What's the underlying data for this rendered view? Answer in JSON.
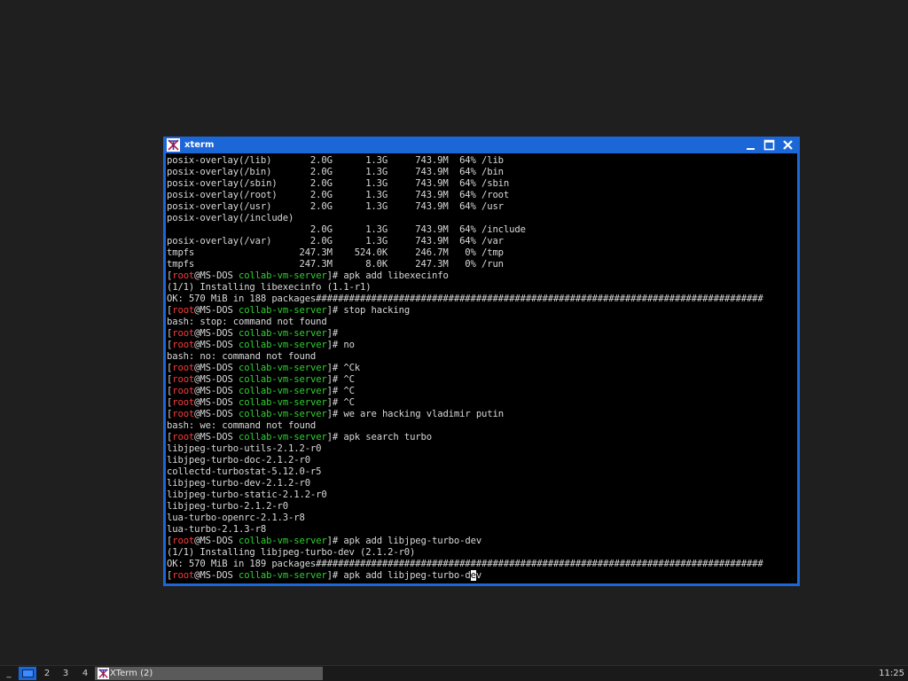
{
  "window": {
    "title": "xterm",
    "colors": {
      "titlebar": "#1c67d8",
      "terminal_bg": "#000000",
      "text": "#d8d8d8",
      "user": "#ff3a3a",
      "dir": "#2fd02f"
    }
  },
  "prompt": {
    "open": "[",
    "user": "root",
    "at": "@",
    "host": "MS-DOS",
    "space": " ",
    "dir": "collab-vm-server",
    "close": "]# "
  },
  "terminal": {
    "lines": [
      {
        "text": "posix-overlay(/lib)       2.0G      1.3G     743.9M  64% /lib"
      },
      {
        "text": "posix-overlay(/bin)       2.0G      1.3G     743.9M  64% /bin"
      },
      {
        "text": "posix-overlay(/sbin)      2.0G      1.3G     743.9M  64% /sbin"
      },
      {
        "text": "posix-overlay(/root)      2.0G      1.3G     743.9M  64% /root"
      },
      {
        "text": "posix-overlay(/usr)       2.0G      1.3G     743.9M  64% /usr"
      },
      {
        "text": "posix-overlay(/include)"
      },
      {
        "text": "                          2.0G      1.3G     743.9M  64% /include"
      },
      {
        "text": "posix-overlay(/var)       2.0G      1.3G     743.9M  64% /var"
      },
      {
        "text": "tmpfs                   247.3M    524.0K     246.7M   0% /tmp"
      },
      {
        "text": "tmpfs                   247.3M      8.0K     247.3M   0% /run"
      },
      {
        "prompt": true,
        "cmd": "apk add libexecinfo"
      },
      {
        "text": "(1/1) Installing libexecinfo (1.1-r1)"
      },
      {
        "text": "OK: 570 MiB in 188 packages#################################################################################"
      },
      {
        "prompt": true,
        "cmd": "stop hacking"
      },
      {
        "text": "bash: stop: command not found"
      },
      {
        "prompt": true,
        "cmd": ""
      },
      {
        "prompt": true,
        "cmd": "no"
      },
      {
        "text": "bash: no: command not found"
      },
      {
        "prompt": true,
        "cmd": "^Ck"
      },
      {
        "prompt": true,
        "cmd": "^C"
      },
      {
        "prompt": true,
        "cmd": "^C"
      },
      {
        "prompt": true,
        "cmd": "^C"
      },
      {
        "prompt": true,
        "cmd": "we are hacking vladimir putin"
      },
      {
        "text": "bash: we: command not found"
      },
      {
        "prompt": true,
        "cmd": "apk search turbo"
      },
      {
        "text": "libjpeg-turbo-utils-2.1.2-r0"
      },
      {
        "text": "libjpeg-turbo-doc-2.1.2-r0"
      },
      {
        "text": "collectd-turbostat-5.12.0-r5"
      },
      {
        "text": "libjpeg-turbo-dev-2.1.2-r0"
      },
      {
        "text": "libjpeg-turbo-static-2.1.2-r0"
      },
      {
        "text": "libjpeg-turbo-2.1.2-r0"
      },
      {
        "text": "lua-turbo-openrc-2.1.3-r8"
      },
      {
        "text": "lua-turbo-2.1.3-r8"
      },
      {
        "prompt": true,
        "cmd": "apk add libjpeg-turbo-dev"
      },
      {
        "text": "(1/1) Installing libjpeg-turbo-dev (2.1.2-r0)"
      },
      {
        "text": "OK: 570 MiB in 189 packages#################################################################################"
      },
      {
        "prompt": true,
        "cmd": "apk add libjpeg-turbo-d",
        "cursor": "e",
        "after": "v"
      }
    ]
  },
  "taskbar": {
    "menu_label": "_",
    "workspaces": [
      "1",
      "2",
      "3",
      "4"
    ],
    "task_label": "XTerm (2)",
    "clock": "11:25"
  }
}
